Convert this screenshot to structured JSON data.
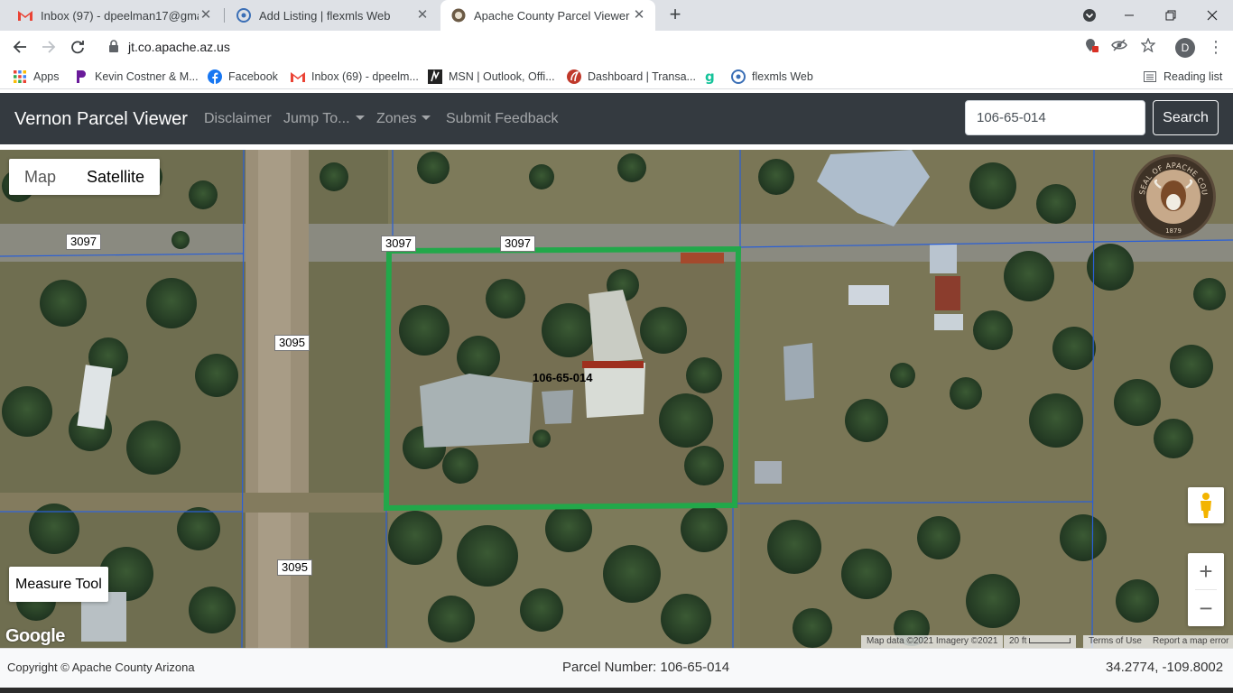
{
  "browser": {
    "tabs": [
      {
        "title": "Inbox (97) - dpeelman17@gmail.",
        "icon": "gmail-icon",
        "close": "✕"
      },
      {
        "title": "Add Listing | flexmls Web",
        "icon": "flexmls-icon",
        "close": "✕"
      },
      {
        "title": "Apache County Parcel Viewer",
        "icon": "apache-seal-icon",
        "close": "✕"
      }
    ],
    "new_tab": "+",
    "url": "jt.co.apache.az.us",
    "profile_initial": "D",
    "bookmarks": [
      {
        "label": "Apps",
        "icon": "apps-grid-icon"
      },
      {
        "label": "Kevin Costner & M...",
        "icon": "peacock-icon"
      },
      {
        "label": "Facebook",
        "icon": "facebook-icon"
      },
      {
        "label": "Inbox (69) - dpeelm...",
        "icon": "gmail-icon"
      },
      {
        "label": "MSN | Outlook, Offi...",
        "icon": "msn-icon"
      },
      {
        "label": "Dashboard | Transa...",
        "icon": "transactiondesk-icon"
      },
      {
        "label": "",
        "icon": "grammarly-icon"
      },
      {
        "label": "flexmls Web",
        "icon": "flexmls-icon"
      }
    ],
    "reading_list": "Reading list"
  },
  "navbar": {
    "brand": "Vernon Parcel Viewer",
    "links": {
      "disclaimer": "Disclaimer",
      "jump_to": "Jump To...",
      "zones": "Zones",
      "feedback": "Submit Feedback"
    },
    "search_value": "106-65-014",
    "search_button": "Search"
  },
  "map": {
    "map_type": {
      "map": "Map",
      "satellite": "Satellite",
      "selected": "Satellite"
    },
    "road_labels": {
      "a": "3097",
      "b": "3097",
      "c": "3097",
      "d": "3095",
      "e": "3095"
    },
    "parcel_label": "106-65-014",
    "seal_text": "SEAL OF APACHE COUNTY ARIZONA",
    "seal_year": "1879",
    "measure_tool": "Measure Tool",
    "google_logo": "Google",
    "attribution": {
      "map_data": "Map data ©2021 Imagery ©2021",
      "scale": "20 ft",
      "terms": "Terms of Use",
      "report": "Report a map error"
    },
    "zoom_in": "+",
    "zoom_out": "−",
    "highlight_color": "#22a84a",
    "parcel_line_color": "#2a5fd6"
  },
  "footer": {
    "copyright": "Copyright © Apache County Arizona",
    "parcel_number": "Parcel Number: 106-65-014",
    "coordinates": "34.2774, -109.8002"
  }
}
